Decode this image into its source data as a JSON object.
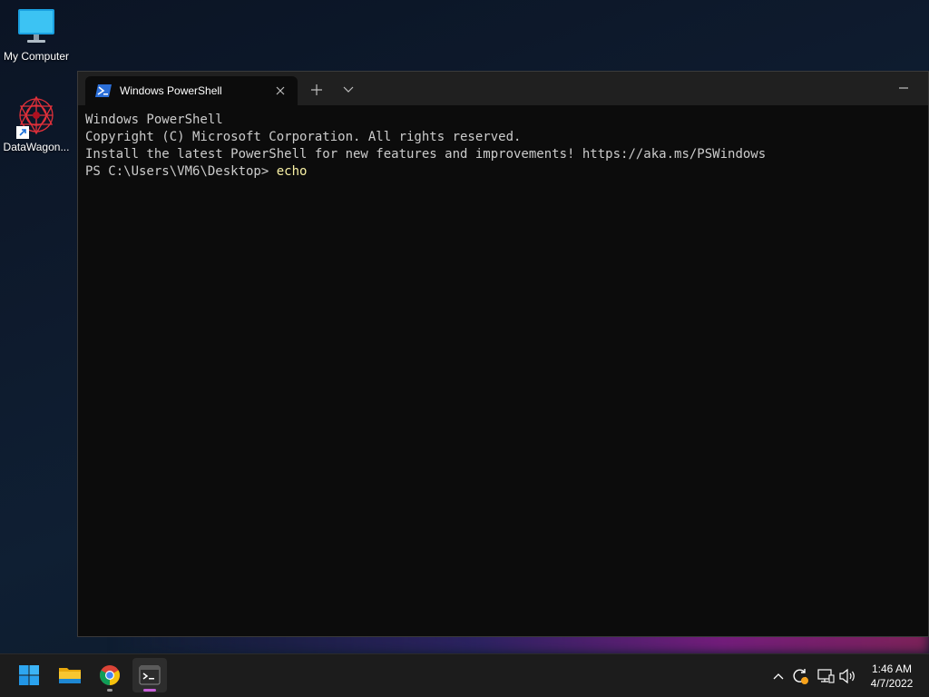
{
  "desktop": {
    "icons": [
      {
        "label": "My Computer",
        "icon": "monitor-icon"
      },
      {
        "label": "DataWagon...",
        "icon": "datawagon-app-icon"
      }
    ]
  },
  "terminal": {
    "tab_title": "Windows PowerShell",
    "lines": [
      "Windows PowerShell",
      "Copyright (C) Microsoft Corporation. All rights reserved.",
      "",
      "Install the latest PowerShell for new features and improvements! https://aka.ms/PSWindows",
      ""
    ],
    "prompt": "PS C:\\Users\\VM6\\Desktop> ",
    "command": "echo"
  },
  "taskbar": {
    "apps": [
      "start-icon",
      "file-explorer-icon",
      "chrome-icon",
      "terminal-icon"
    ],
    "active_app": "terminal-icon",
    "tray": [
      "chevron-up-icon",
      "update-icon",
      "network-icon",
      "volume-icon"
    ],
    "clock": {
      "time": "1:46 AM",
      "date": "4/7/2022"
    }
  },
  "colors": {
    "terminal_bg": "#0c0c0c",
    "titlebar_bg": "#202020",
    "text": "#cccccc",
    "command": "#f9f1a5",
    "taskbar_bg": "#1c1c1c"
  }
}
